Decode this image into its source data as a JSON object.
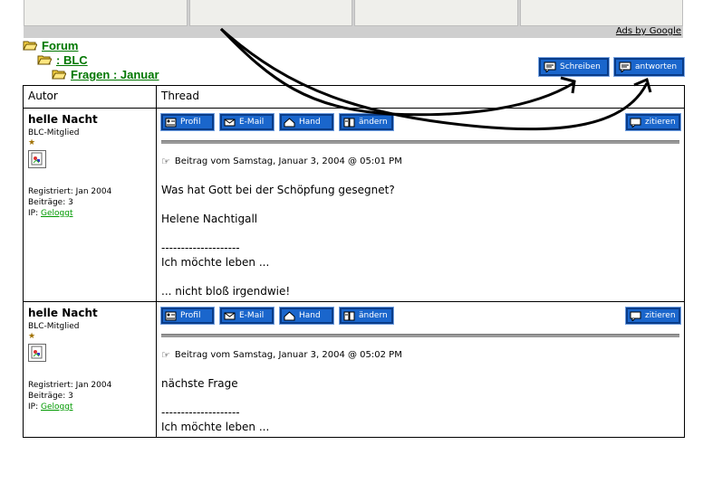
{
  "ads": {
    "label": "Ads by Google"
  },
  "breadcrumb": [
    "Forum",
    ": BLC",
    "Fragen : Januar"
  ],
  "top_buttons": {
    "new_topic": "Schreiben",
    "reply": "antworten"
  },
  "table": {
    "col_author": "Autor",
    "col_thread": "Thread"
  },
  "post_buttons": {
    "profile": "Profil",
    "email": "E-Mail",
    "hand": "Hand",
    "edit": "ändern",
    "quote": "zitieren"
  },
  "posts": [
    {
      "author": "helle Nacht",
      "role": "BLC-Mitglied",
      "registered": "Registriert: Jan 2004",
      "posts_count": "Beiträge: 3",
      "ip_label": "IP:",
      "ip_value": "Geloggt",
      "posted": "Beitrag vom Samstag, Januar 3, 2004 @ 05:01 PM",
      "lines": [
        "Was hat Gott bei der Schöpfung gesegnet?",
        "Helene Nachtigall",
        "--------------------",
        "Ich möchte leben ...",
        "... nicht bloß irgendwie!"
      ]
    },
    {
      "author": "helle Nacht",
      "role": "BLC-Mitglied",
      "registered": "Registriert: Jan 2004",
      "posts_count": "Beiträge: 3",
      "ip_label": "IP:",
      "ip_value": "Geloggt",
      "posted": "Beitrag vom Samstag, Januar 3, 2004 @ 05:02 PM",
      "lines": [
        "nächste Frage",
        "--------------------",
        "Ich möchte leben ..."
      ]
    }
  ],
  "colors": {
    "button_blue": "#1a66cc",
    "link_green": "#007700",
    "ad_bar": "#cfcfcf"
  }
}
